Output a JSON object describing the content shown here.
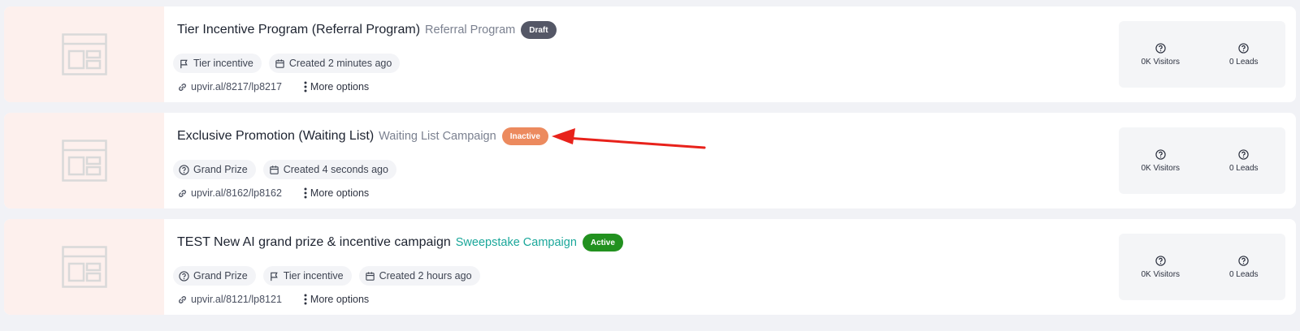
{
  "campaigns": [
    {
      "title": "Tier Incentive Program (Referral Program)",
      "type": "Referral Program",
      "status": "Draft",
      "chips": [
        "Tier incentive",
        "Created 2 minutes ago"
      ],
      "url": "upvir.al/8217/lp8217",
      "more": "More options",
      "visitors": "0K Visitors",
      "leads": "0 Leads"
    },
    {
      "title": "Exclusive Promotion (Waiting List)",
      "type": "Waiting List Campaign",
      "status": "Inactive",
      "chips": [
        "Grand Prize",
        "Created 4 seconds ago"
      ],
      "url": "upvir.al/8162/lp8162",
      "more": "More options",
      "visitors": "0K Visitors",
      "leads": "0 Leads"
    },
    {
      "title": "TEST New AI grand prize & incentive campaign",
      "type": "Sweepstake Campaign",
      "status": "Active",
      "chips": [
        "Grand Prize",
        "Tier incentive",
        "Created 2 hours ago"
      ],
      "url": "upvir.al/8121/lp8121",
      "more": "More options",
      "visitors": "0K Visitors",
      "leads": "0 Leads"
    }
  ],
  "colors": {
    "draft": "#545766",
    "inactive": "#ec8a5e",
    "active": "#22911f",
    "sweepstake_type": "#1aa79a",
    "annotation_arrow": "#e8221b"
  },
  "icons": {
    "thumbnail": "layout-template-icon",
    "tier": "flag-icon",
    "grand_prize": "question-circle-icon",
    "created": "calendar-icon",
    "url": "link-icon",
    "more": "vertical-dots-icon",
    "stats": "question-circle-icon"
  }
}
